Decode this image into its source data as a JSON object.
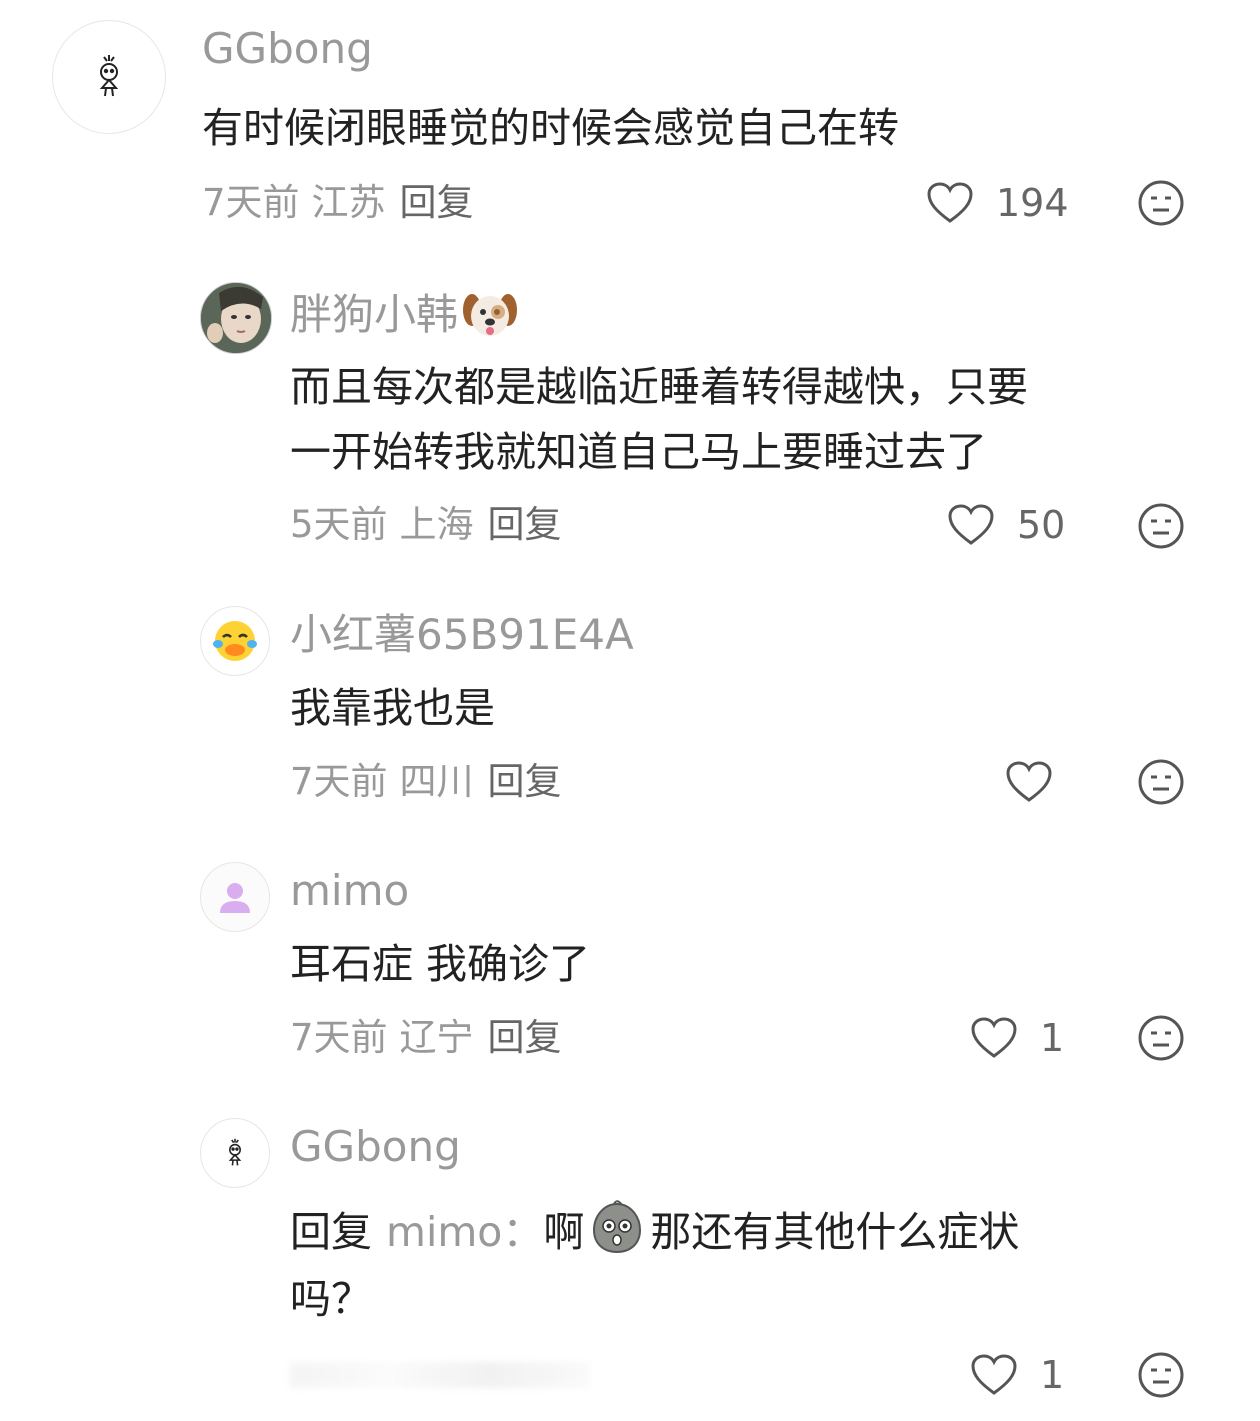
{
  "comments": [
    {
      "username": "GGbong",
      "text": "有时候闭眼睡觉的时候会感觉自己在转",
      "time": "7天前",
      "location": "江苏",
      "reply_label": "回复",
      "likes": "194",
      "avatar_icon": "stick-figure-avatar"
    },
    {
      "username": "胖狗小韩",
      "username_emoji": "dog-face-emoji",
      "text_lines": [
        "而且每次都是越临近睡着转得越快，只要",
        "一开始转我就知道自己马上要睡过去了"
      ],
      "time": "5天前",
      "location": "上海",
      "reply_label": "回复",
      "likes": "50",
      "avatar_icon": "photo-avatar"
    },
    {
      "username": "小红薯65B91E4A",
      "text": "我靠我也是",
      "time": "7天前",
      "location": "四川",
      "reply_label": "回复",
      "likes": "",
      "avatar_icon": "laughing-duck-avatar"
    },
    {
      "username": "mimo",
      "text": "耳石症 我确诊了",
      "time": "7天前",
      "location": "辽宁",
      "reply_label": "回复",
      "likes": "1",
      "avatar_icon": "default-user-avatar"
    },
    {
      "username": "GGbong",
      "reply_prefix": "回复",
      "reply_target": "mimo：",
      "text_part1": "啊",
      "text_emoji": "shocked-face-emoji",
      "text_part2": "那还有其他什么症状",
      "text_line2": "吗？",
      "likes": "1",
      "avatar_icon": "stick-figure-avatar"
    }
  ],
  "icons": {
    "like": "heart-icon",
    "dislike": "meh-face-icon"
  },
  "colors": {
    "text": "#222222",
    "secondary": "#999999",
    "icon": "#555555"
  }
}
